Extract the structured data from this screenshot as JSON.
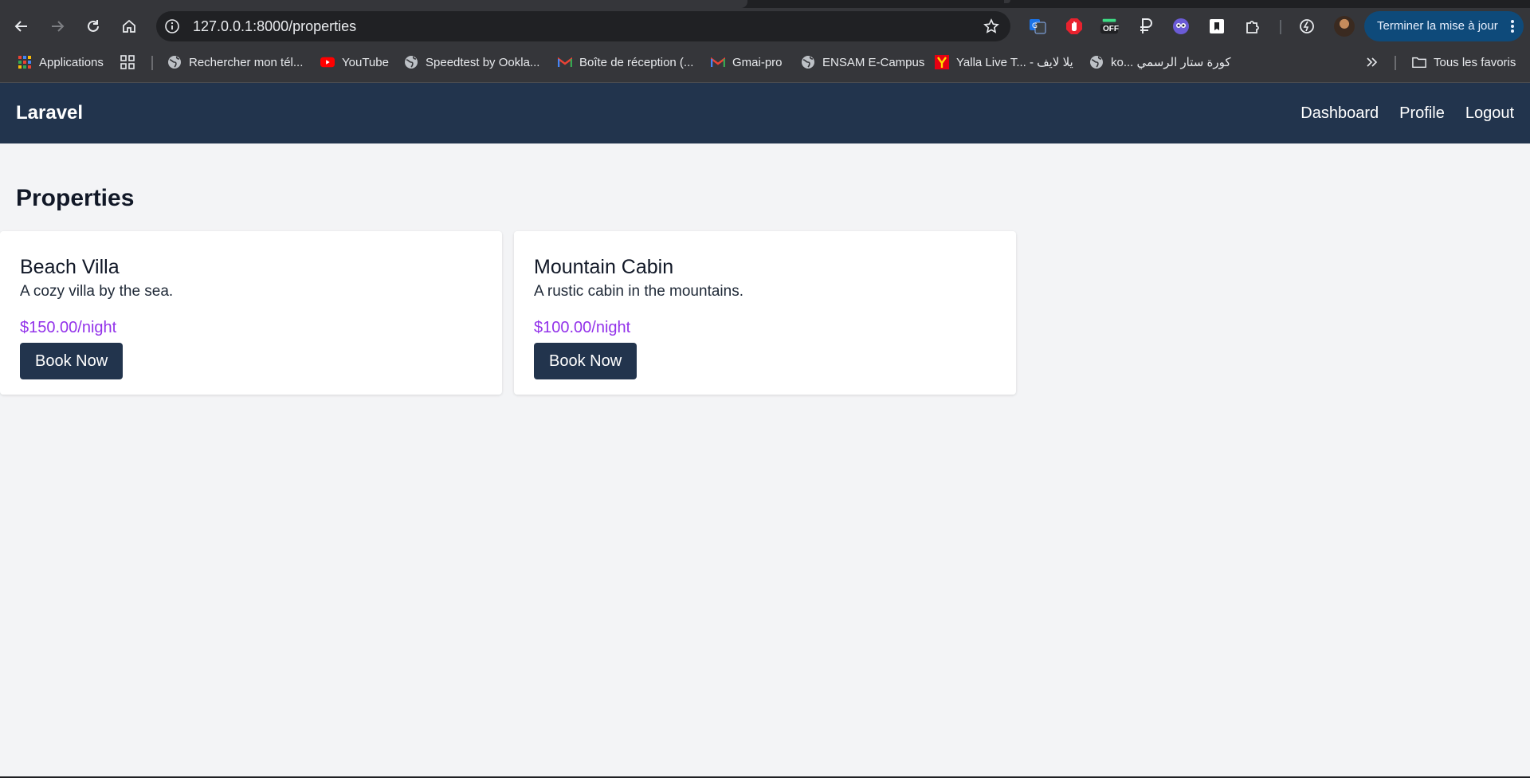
{
  "browser": {
    "url": "127.0.0.1:8000/properties",
    "update_button": "Terminer la mise à jour",
    "extensions": [
      "translate-extension-icon",
      "adblock-icon",
      "off-badge-extension-icon",
      "ruble-extension-icon",
      "ghost-extension-icon",
      "bookmark-extension-icon",
      "extensions-puzzle-icon",
      "performance-icon"
    ],
    "off_badge": "OFF",
    "bookmarks": [
      {
        "label": "Applications",
        "icon": "apps-grid-icon"
      },
      {
        "label": "Rechercher mon tél...",
        "icon": "globe-icon"
      },
      {
        "label": "YouTube",
        "icon": "youtube-icon"
      },
      {
        "label": "Speedtest by Ookla...",
        "icon": "globe-icon"
      },
      {
        "label": "Boîte de réception (...",
        "icon": "gmail-icon"
      },
      {
        "label": "Gmai-pro",
        "icon": "gmail-icon"
      },
      {
        "label": "ENSAM E-Campus",
        "icon": "globe-icon"
      },
      {
        "label": "Yalla Live T... - يلا لايف",
        "icon": "yalla-icon"
      },
      {
        "label": "ko... كورة ستار الرسمي",
        "icon": "globe-icon"
      }
    ],
    "all_bookmarks": "Tous les favoris"
  },
  "app": {
    "brand": "Laravel",
    "nav": {
      "dashboard": "Dashboard",
      "profile": "Profile",
      "logout": "Logout"
    },
    "page_title": "Properties",
    "properties": [
      {
        "name": "Beach Villa",
        "description": "A cozy villa by the sea.",
        "price": "$150.00/night",
        "button": "Book Now"
      },
      {
        "name": "Mountain Cabin",
        "description": "A rustic cabin in the mountains.",
        "price": "$100.00/night",
        "button": "Book Now"
      }
    ]
  },
  "colors": {
    "navbar": "#22344d",
    "price": "#9333ea",
    "background": "#f3f4f6",
    "browser_chrome": "#35363a",
    "update_button": "#0e4a7a"
  }
}
